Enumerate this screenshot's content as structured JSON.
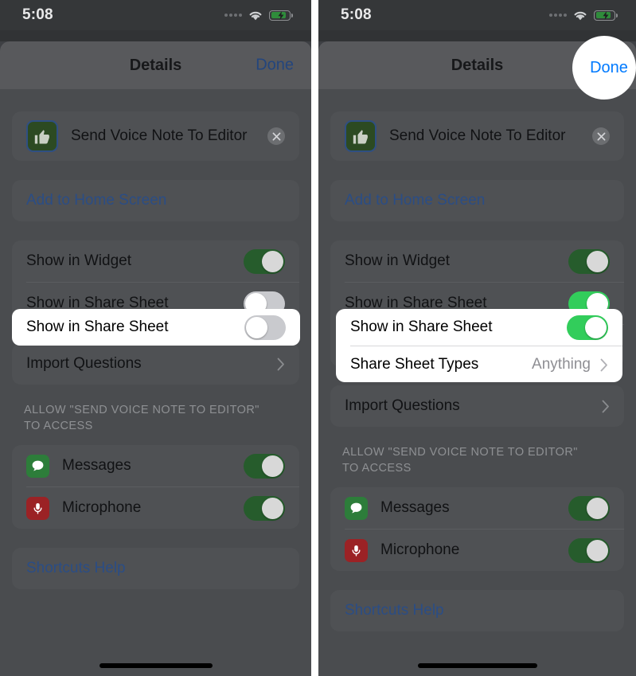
{
  "status_bar": {
    "time": "5:08",
    "signal_icon": "signal-dots-icon",
    "wifi_icon": "wifi-icon",
    "battery_icon": "battery-charging-icon"
  },
  "nav": {
    "title": "Details",
    "done_label": "Done"
  },
  "shortcut": {
    "name": "Send Voice Note To Editor",
    "icon": "thumbs-up-icon",
    "clear_icon": "clear-circle-icon"
  },
  "add_home": {
    "label": "Add to Home Screen"
  },
  "toggles": {
    "show_in_widget": "Show in Widget",
    "show_in_share_sheet": "Show in Share Sheet",
    "share_sheet_types": "Share Sheet Types",
    "share_sheet_types_value": "Anything"
  },
  "import": {
    "label": "Import Questions",
    "chevron_icon": "chevron-right-icon"
  },
  "allow_section": {
    "header_line1": "ALLOW \"SEND VOICE NOTE TO EDITOR\"",
    "header_line2": "TO ACCESS",
    "items": [
      {
        "label": "Messages",
        "icon": "messages-icon",
        "enabled": "on"
      },
      {
        "label": "Microphone",
        "icon": "microphone-icon",
        "enabled": "on"
      }
    ]
  },
  "help": {
    "label": "Shortcuts Help"
  },
  "colors": {
    "toggle_on_bright": "#32CD5B",
    "toggle_on_dim": "#265C2C",
    "toggle_off": "#C9CACE",
    "link_blue": "#007AFF",
    "sheet_bg": "#4A4C4F",
    "card_bg": "#4F5154",
    "highlight_white": "#FFFFFF",
    "messages_icon_bg": "#2D7D3A",
    "microphone_icon_bg": "#9B2225",
    "shortcut_icon_bg": "#2C4A22"
  },
  "panels": {
    "left": {
      "share_sheet_state": "off",
      "share_sheet_types_visible": "no"
    },
    "right": {
      "share_sheet_state": "on",
      "share_sheet_types_visible": "yes"
    }
  }
}
